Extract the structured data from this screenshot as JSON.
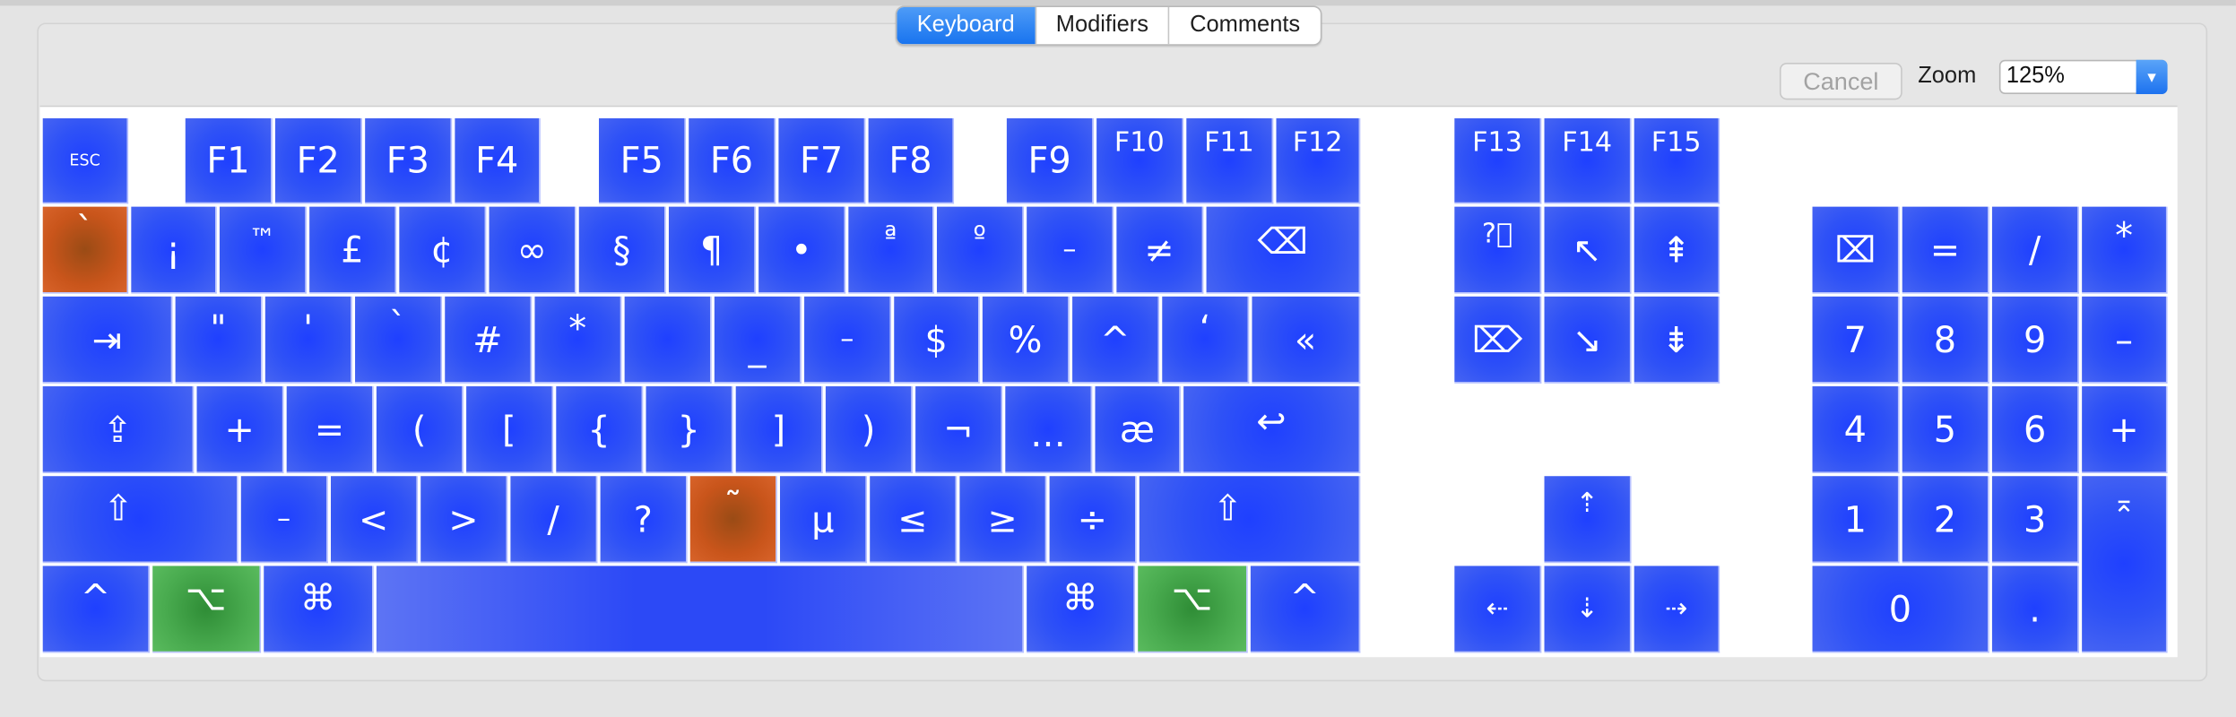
{
  "tabs": [
    {
      "label": "Keyboard",
      "active": true
    },
    {
      "label": "Modifiers",
      "active": false
    },
    {
      "label": "Comments",
      "active": false
    }
  ],
  "toolbar": {
    "cancel_label": "Cancel",
    "zoom_label": "Zoom",
    "zoom_value": "125%"
  },
  "keys": {
    "esc": "ESC",
    "f1": "F1",
    "f2": "F2",
    "f3": "F3",
    "f4": "F4",
    "f5": "F5",
    "f6": "F6",
    "f7": "F7",
    "f8": "F8",
    "f9": "F9",
    "f10": "F10",
    "f11": "F11",
    "f12": "F12",
    "f13": "F13",
    "f14": "F14",
    "f15": "F15",
    "grave": "`",
    "exclaim_inv": "¡",
    "trademark": "™",
    "pound": "£",
    "cent": "¢",
    "infinity": "∞",
    "section": "§",
    "pilcrow": "¶",
    "bullet": "•",
    "ordinal_a": "ª",
    "ordinal_o": "º",
    "dash": "–",
    "not_equal": "≠",
    "delete_glyph": "⌫",
    "tab_glyph": "⇥",
    "dquote": "\"",
    "squote": "'",
    "backtick": "`",
    "hash": "#",
    "asterisk": "*",
    "blank": "",
    "underscore": "_",
    "minus": "–",
    "dollar": "$",
    "percent": "%",
    "caret": "^",
    "lquote": "‘",
    "guillemet": "«",
    "capslock_glyph": "⇪",
    "plus": "+",
    "equals": "=",
    "lparen": "(",
    "lbracket": "[",
    "lbrace": "{",
    "rbrace": "}",
    "rbracket": "]",
    "rparen": ")",
    "not_sign": "¬",
    "ellipsis": "…",
    "ae": "æ",
    "return_glyph": "↩",
    "shift_glyph": "⇧",
    "hyphen": "–",
    "less": "<",
    "greater": ">",
    "slash": "/",
    "question": "?",
    "tilde": "˜",
    "micro": "µ",
    "leq": "≤",
    "geq": "≥",
    "divide": "÷",
    "control_glyph": "^",
    "option_glyph": "⌥",
    "command_glyph": "⌘",
    "space": "",
    "help_glyph": "?⃝",
    "home_glyph": "↖",
    "pageup_glyph": "⇞",
    "fwd_delete_glyph": "⌦",
    "end_glyph": "↘",
    "pagedown_glyph": "⇟",
    "up_glyph": "⇡",
    "left_glyph": "⇠",
    "down_glyph": "⇣",
    "right_glyph": "⇢",
    "clear_glyph": "⌧",
    "np_equals": "=",
    "np_slash": "/",
    "np_asterisk": "*",
    "np_7": "7",
    "np_8": "8",
    "np_9": "9",
    "np_minus": "–",
    "np_4": "4",
    "np_5": "5",
    "np_6": "6",
    "np_plus": "+",
    "np_1": "1",
    "np_2": "2",
    "np_3": "3",
    "np_enter_glyph": "⌅",
    "np_0": "0",
    "np_dot": "."
  },
  "colors": {
    "key_blue": "#2f52f6",
    "dead_key_orange": "#c9551b",
    "pressed_modifier_green": "#49ab4f",
    "tab_active": "#1873ef"
  }
}
